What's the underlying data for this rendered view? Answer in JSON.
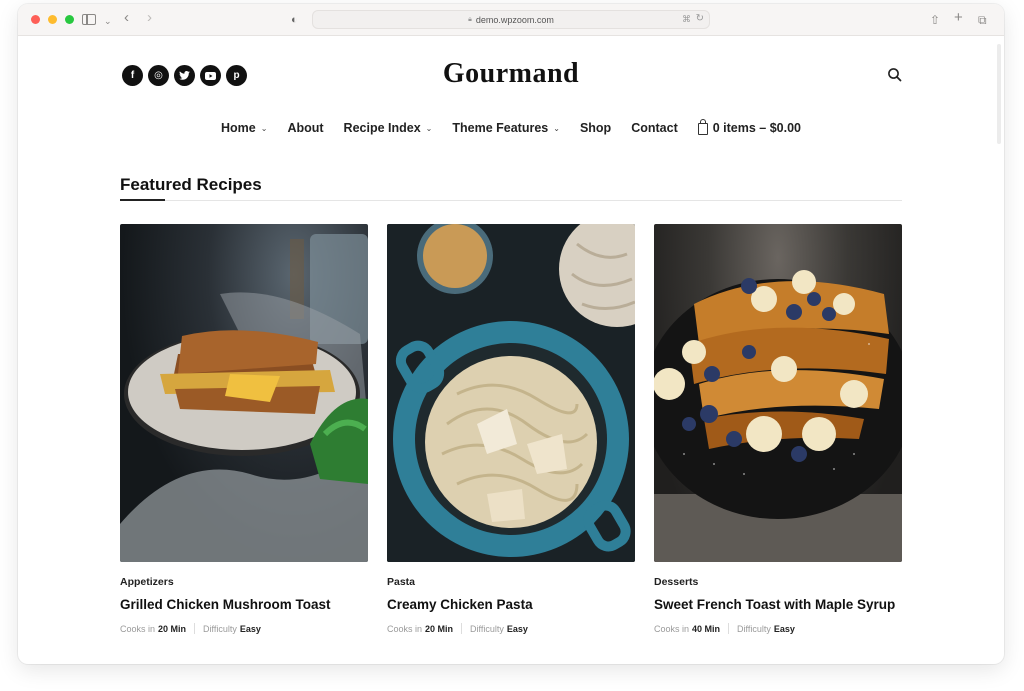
{
  "browser": {
    "url": "demo.wpzoom.com"
  },
  "site": {
    "logo": "Gourmand",
    "socials": [
      {
        "name": "facebook",
        "glyph": "f"
      },
      {
        "name": "instagram",
        "glyph": "◎"
      },
      {
        "name": "twitter",
        "glyph": "🐦"
      },
      {
        "name": "youtube",
        "glyph": "▶"
      },
      {
        "name": "pinterest",
        "glyph": "p"
      }
    ]
  },
  "nav": {
    "items": [
      {
        "label": "Home",
        "dropdown": true
      },
      {
        "label": "About",
        "dropdown": false
      },
      {
        "label": "Recipe Index",
        "dropdown": true
      },
      {
        "label": "Theme Features",
        "dropdown": true
      },
      {
        "label": "Shop",
        "dropdown": false
      },
      {
        "label": "Contact",
        "dropdown": false
      }
    ],
    "cart_label": "0 items – $0.00",
    "chevron": "⌄"
  },
  "featured": {
    "title": "Featured Recipes",
    "cooks_label": "Cooks in",
    "difficulty_label": "Difficulty",
    "recipes": [
      {
        "category": "Appetizers",
        "title": "Grilled Chicken Mushroom Toast",
        "time": "20 Min",
        "difficulty": "Easy"
      },
      {
        "category": "Pasta",
        "title": "Creamy Chicken Pasta",
        "time": "20 Min",
        "difficulty": "Easy"
      },
      {
        "category": "Desserts",
        "title": "Sweet French Toast with Maple Syrup",
        "time": "40 Min",
        "difficulty": "Easy"
      }
    ]
  }
}
